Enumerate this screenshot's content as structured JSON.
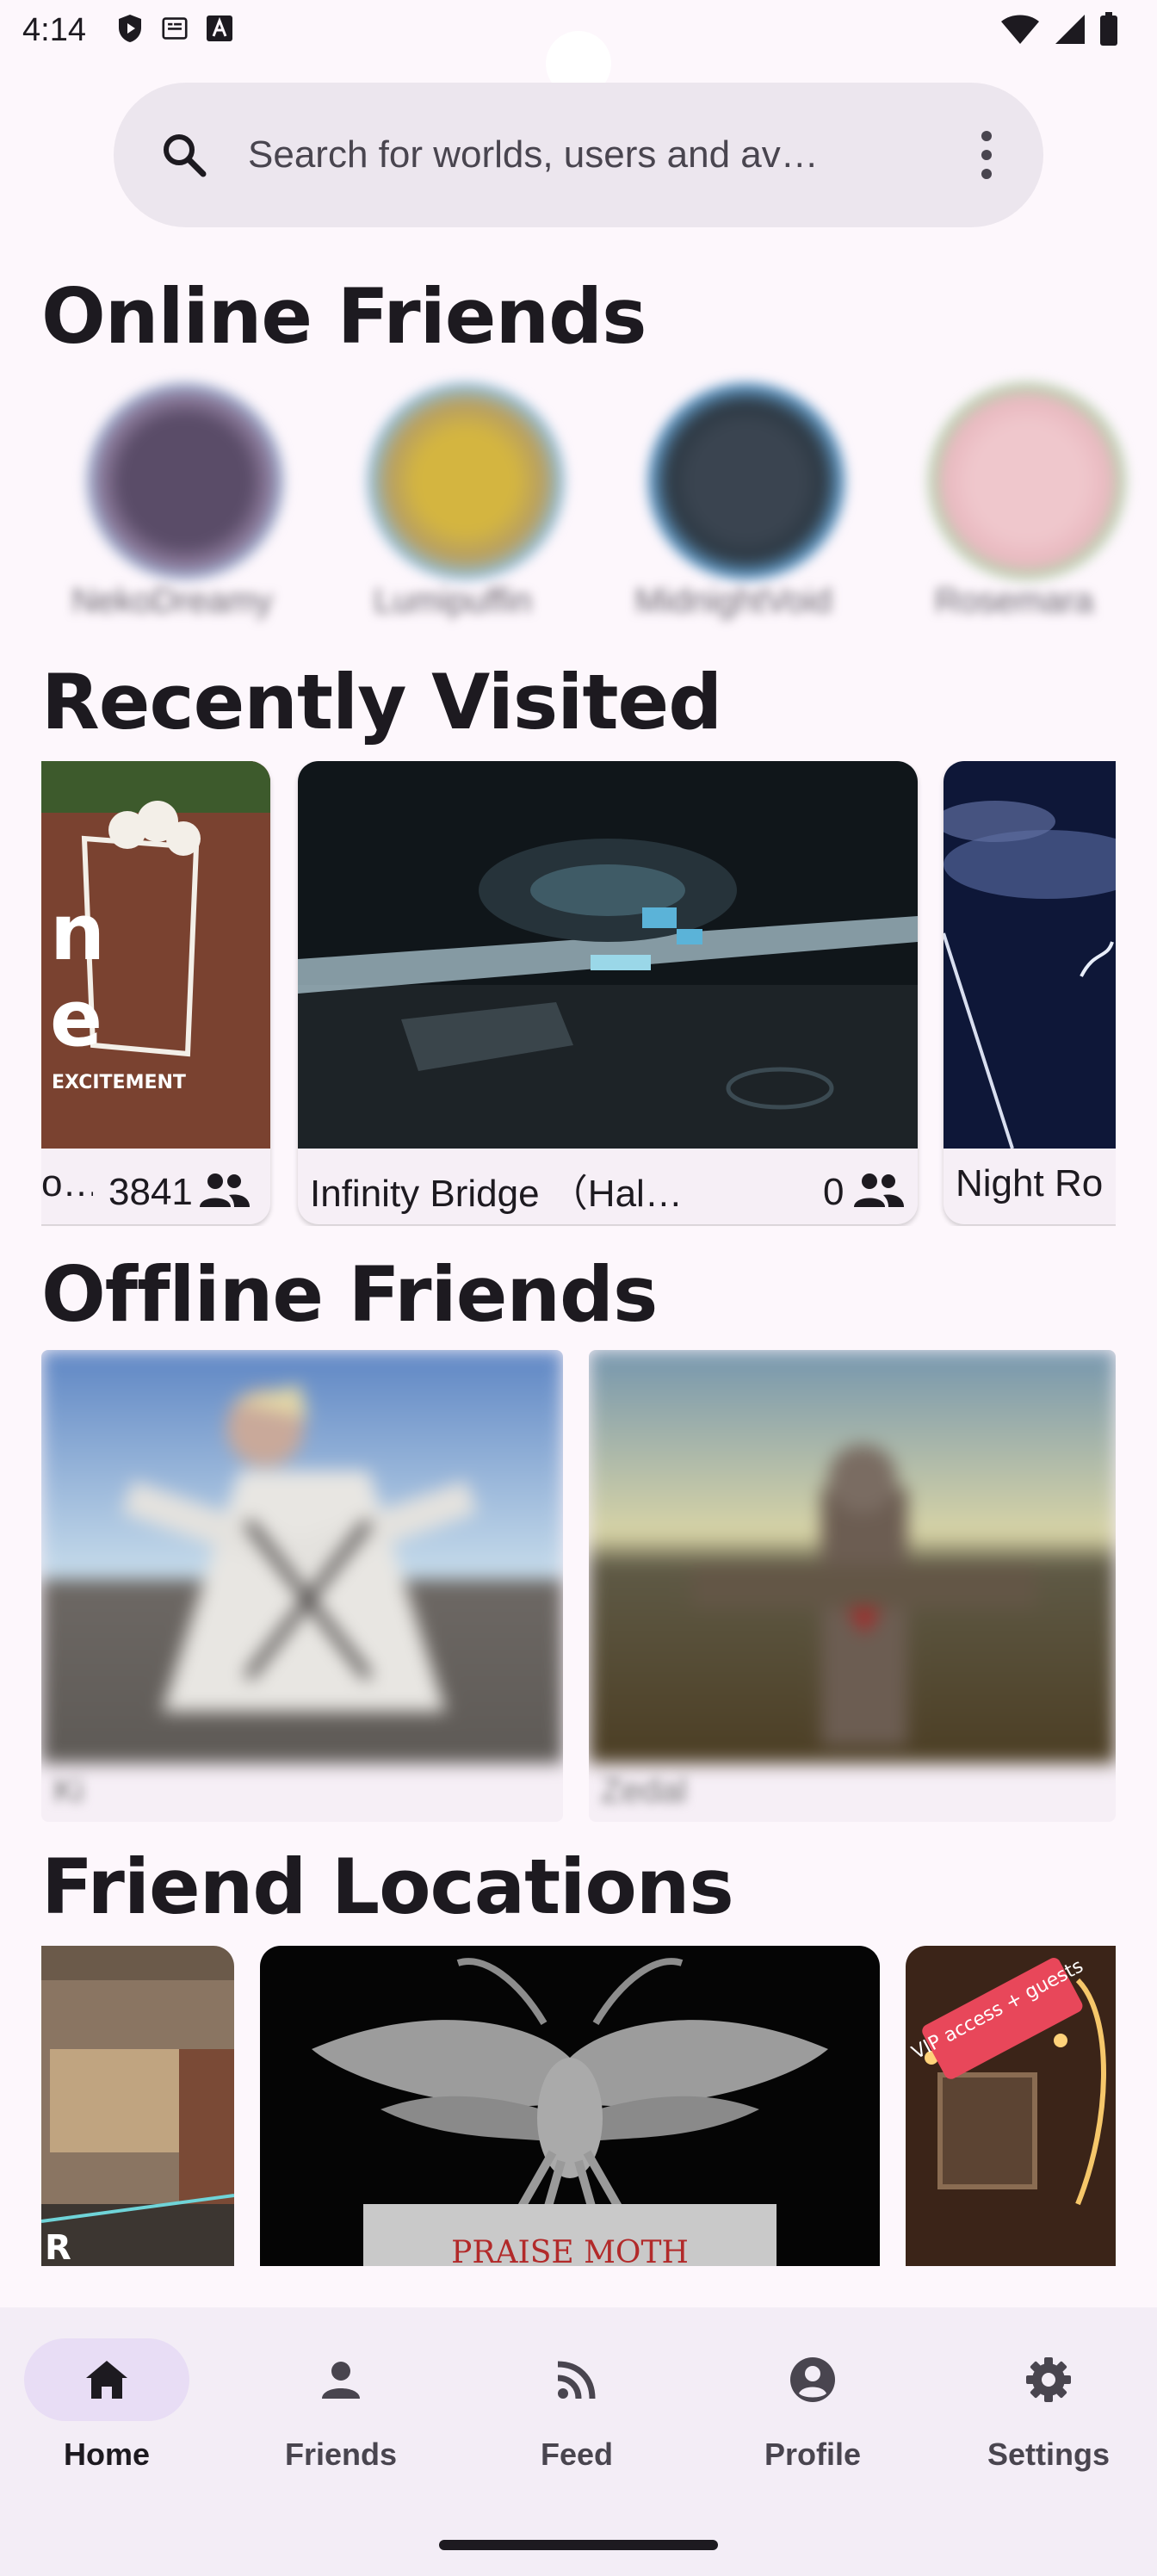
{
  "status_bar": {
    "time": "4:14",
    "icons": [
      "shield-play-icon",
      "nfc-icon",
      "font-a-icon",
      "wifi-icon",
      "signal-icon",
      "battery-icon"
    ]
  },
  "search": {
    "placeholder": "Search for worlds, users and av…",
    "icon": "search-icon",
    "menu_icon": "more-vert-icon"
  },
  "sections": {
    "online_friends": "Online Friends",
    "recently_visited": "Recently Visited",
    "offline_friends": "Offline Friends",
    "friend_locations": "Friend Locations"
  },
  "online_friends": [
    {
      "name": "NekoDreamy",
      "ring": "#9ec9f0"
    },
    {
      "name": "Lumipuffin",
      "ring": "#86c4ef"
    },
    {
      "name": "MidnightVoid",
      "ring": "#7ab9e8"
    },
    {
      "name": "Rosemara",
      "ring": "#9ee0a8"
    }
  ],
  "recently_visited": [
    {
      "name": "Popcorn Palace",
      "count": "3841",
      "truncated_label": "o…"
    },
    {
      "name": "Infinity Bridge （Hal…",
      "count": "0"
    },
    {
      "name": "Night Ro",
      "count": ""
    }
  ],
  "offline_friends": [
    {
      "name": "Ki"
    },
    {
      "name": "Zedal"
    }
  ],
  "friend_locations": [
    {
      "label": "R"
    },
    {
      "label": "PRAISE MOTH"
    },
    {
      "label": "VIP access + guests"
    }
  ],
  "nav": {
    "items": [
      {
        "label": "Home",
        "icon": "home-icon",
        "active": true
      },
      {
        "label": "Friends",
        "icon": "person-icon",
        "active": false
      },
      {
        "label": "Feed",
        "icon": "rss-feed-icon",
        "active": false
      },
      {
        "label": "Profile",
        "icon": "account-circle-icon",
        "active": false
      },
      {
        "label": "Settings",
        "icon": "gear-icon",
        "active": false
      }
    ]
  },
  "colors": {
    "background": "#fdf7fc",
    "search_bg": "#ece6ee",
    "nav_bg": "#f3edf6",
    "nav_active_pill": "#e8ddf5",
    "text": "#1d1a20"
  }
}
